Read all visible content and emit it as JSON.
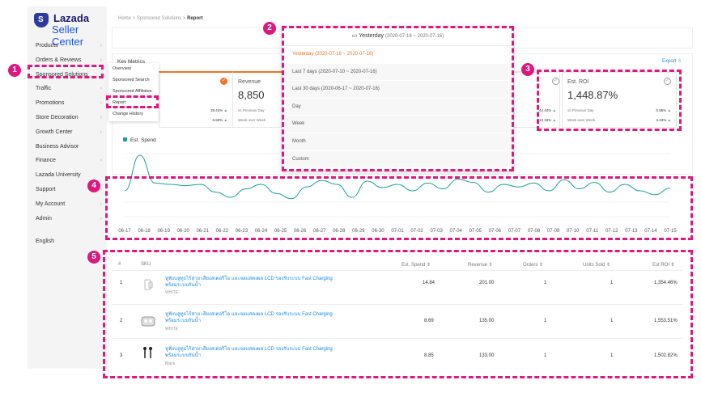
{
  "brand": {
    "name": "Lazada",
    "sub": "Seller Center",
    "mark": "S"
  },
  "sidebar": {
    "items": [
      {
        "label": "Products",
        "chev": "›"
      },
      {
        "label": "Orders & Reviews",
        "chev": "›"
      },
      {
        "label": "Sponsored Solutions",
        "chev": "›"
      },
      {
        "label": "Traffic",
        "chev": "›"
      },
      {
        "label": "Promotions",
        "chev": "›"
      },
      {
        "label": "Store Decoration",
        "chev": "›"
      },
      {
        "label": "Growth Center",
        "chev": "›"
      },
      {
        "label": "Business Advisor",
        "chev": ""
      },
      {
        "label": "Finance",
        "chev": "›"
      },
      {
        "label": "Lazada University",
        "chev": ""
      },
      {
        "label": "Support",
        "chev": "›"
      },
      {
        "label": "My Account",
        "chev": "›"
      },
      {
        "label": "Admin",
        "chev": "›"
      }
    ],
    "language": "English"
  },
  "submenu": [
    "Overview",
    "Sponsored Search",
    "Sponsored Affiliates",
    "Report",
    "Change History"
  ],
  "breadcrumb": {
    "home": "Home",
    "sep": ">",
    "section": "Sponsored Solutions",
    "current": "Report"
  },
  "key_metrics": "Key Metrics",
  "export": "Export ⇩",
  "dropdown": {
    "head_label": "Yesterday",
    "head_range": "(2020-07-16 ~ 2020-07-16)",
    "items": [
      {
        "label": "Yesterday",
        "range": "(2020-07-16 ~ 2020-07-16)"
      },
      {
        "label": "Last 7 days",
        "range": "(2020-07-10 ~ 2020-07-16)"
      },
      {
        "label": "Last 30 days",
        "range": "(2020-06-17 ~ 2020-07-16)"
      },
      {
        "label": "Day",
        "range": ""
      },
      {
        "label": "Week",
        "range": ""
      },
      {
        "label": "Month",
        "range": ""
      },
      {
        "label": "Custom",
        "range": ""
      }
    ]
  },
  "metrics": {
    "first": {
      "row1_pct": "39.44%",
      "row2_pct": "6.59%"
    },
    "revenue": {
      "title": "Revenue",
      "value": "8,850",
      "row1": "vs Previous Day",
      "row2": "Week over Week"
    },
    "mid": {
      "row1_pct": "44.44%",
      "row2_pct": "13.33%"
    },
    "roi": {
      "title": "Est. ROI",
      "value": "1,448.87%",
      "row1": "vs Previous Day",
      "row1_pct": "0.85%",
      "row2": "Week over Week",
      "row2_pct": "3.33%"
    }
  },
  "chart_data": {
    "type": "line",
    "series": [
      {
        "name": "Est. Spend",
        "values": [
          40,
          95,
          52,
          50,
          48,
          50,
          38,
          30,
          43,
          50,
          36,
          28,
          46,
          56,
          50,
          30,
          55,
          45,
          50,
          40,
          52,
          43,
          58,
          53,
          38,
          50,
          46,
          52,
          40,
          57,
          43,
          53,
          38,
          50,
          40,
          34,
          44
        ]
      }
    ],
    "x": [
      "06-17",
      "06-18",
      "06-19",
      "06-20",
      "06-21",
      "06-22",
      "06-23",
      "06-24",
      "06-25",
      "06-26",
      "06-27",
      "06-28",
      "06-29",
      "06-30",
      "07-01",
      "07-02",
      "07-03",
      "07-04",
      "07-05",
      "07-06",
      "07-07",
      "07-08",
      "07-09",
      "07-10",
      "07-11",
      "07-12",
      "07-13",
      "07-14",
      "07-15"
    ],
    "grid": true,
    "color": "#1e9e9e"
  },
  "table": {
    "headers": {
      "num": "#",
      "sku": "SKU",
      "spend": "Est. Spend ⇕",
      "revenue": "Revenue ⇕",
      "orders": "Orders ⇕",
      "units": "Units Sold ⇕",
      "roi": "Est ROI ⇕"
    },
    "rows": [
      {
        "num": "1",
        "name": "หูฟังบลูทูธไร้สาย เสียงสเตอริโอ และจอแสดงผล LCD รองรับระบบ Fast Charging พร้อมระบบกันน้ำ",
        "variant": "WHITE",
        "spend": "14.84",
        "revenue": "201.00",
        "orders": "1",
        "units": "1",
        "roi": "1,354.46%"
      },
      {
        "num": "2",
        "name": "หูฟังบลูทูธไร้สาย เสียงสเตอริโอ และจอแสดงผล LCD รองรับระบบ Fast Charging พร้อมระบบกันน้ำ",
        "variant": "WHITE",
        "spend": "8.69",
        "revenue": "135.00",
        "orders": "1",
        "units": "1",
        "roi": "1,553.51%"
      },
      {
        "num": "3",
        "name": "หูฟังบลูทูธไร้สาย เสียงสเตอริโอ และจอแสดงผล LCD รองรับระบบ Fast Charging พร้อมระบบกันน้ำ",
        "variant": "Black",
        "spend": "8.85",
        "revenue": "133.00",
        "orders": "1",
        "units": "1",
        "roi": "1,502.82%"
      }
    ]
  },
  "badges": [
    "1",
    "2",
    "3",
    "4",
    "5"
  ],
  "colors": {
    "accent": "#f57224",
    "annotation": "#e0177f",
    "link": "#1a88e6",
    "line": "#1e9e9e"
  }
}
